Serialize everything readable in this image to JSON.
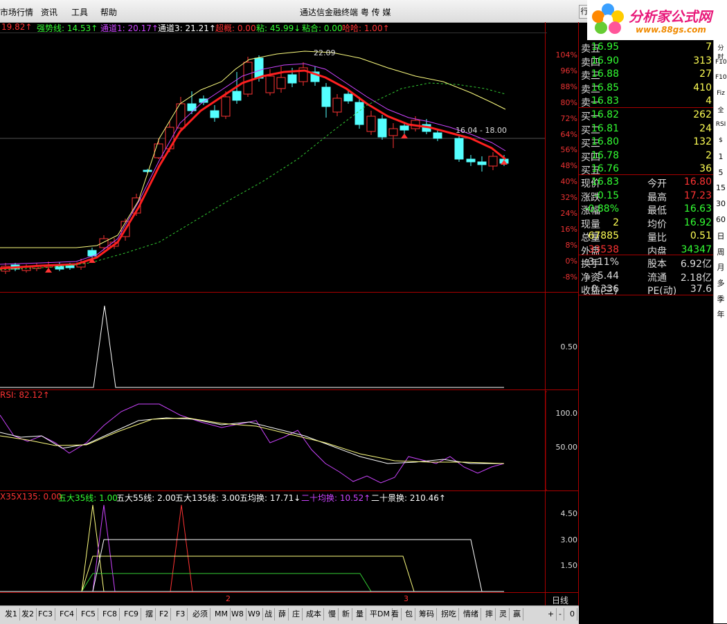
{
  "menu": {
    "items": [
      "市场行情",
      "资讯",
      "工具",
      "帮助"
    ],
    "title": "通达信金融终端  粤 传 媒",
    "left_button": "行"
  },
  "logo": {
    "brand": "分析家公式网",
    "url": "www.88gs.com"
  },
  "info_main": [
    {
      "text": "19.82↑",
      "color": "#ff3333"
    },
    {
      "text": "强势线: 14.53↑",
      "color": "#33ff33"
    },
    {
      "text": "通道1: 20.17↑",
      "color": "#cc44ff"
    },
    {
      "text": "通道3: 21.21↑",
      "color": "#ffffff"
    },
    {
      "text": "超概: 0.00",
      "color": "#ff3333"
    },
    {
      "text": "粘: 45.99↓",
      "color": "#33ff33"
    },
    {
      "text": "粘合: 0.00",
      "color": "#33ff33"
    },
    {
      "text": "哈哈: 1.00↑",
      "color": "#ff3333"
    }
  ],
  "price_axis": [
    "104%",
    "96%",
    "88%",
    "80%",
    "72%",
    "64%",
    "56%",
    "48%",
    "40%",
    "32%",
    "24%",
    "16%",
    "8%",
    "0%",
    "-8%"
  ],
  "annotations": {
    "high": "22.09",
    "range": "16.04 - 18.00"
  },
  "ind1_axis": [
    "0.50"
  ],
  "rsi_label": "RSI: 82.12↑",
  "rsi_axis": [
    "100.0",
    "50.00"
  ],
  "ind3_info": [
    {
      "text": "X35X135: 0.00",
      "color": "#ff3333"
    },
    {
      "text": "五大35线: 1.00",
      "color": "#33ff33"
    },
    {
      "text": "五大55线: 2.00",
      "color": "#ffffff"
    },
    {
      "text": "五大135线: 3.00",
      "color": "#ffffff"
    },
    {
      "text": "五均换: 17.71↓",
      "color": "#ffffff"
    },
    {
      "text": "二十均换: 10.52↑",
      "color": "#cc44ff"
    },
    {
      "text": "二十景换: 210.46↑",
      "color": "#ffffff"
    }
  ],
  "ind3_axis": [
    "4.50",
    "3.00",
    "1.50"
  ],
  "xaxis_marks": [
    "2",
    "3"
  ],
  "period_label": "日线",
  "quote": {
    "asks": [
      [
        "卖五",
        "16.95",
        "7"
      ],
      [
        "卖四",
        "16.90",
        "313"
      ],
      [
        "卖三",
        "16.88",
        "27"
      ],
      [
        "卖二",
        "16.85",
        "410"
      ],
      [
        "卖一",
        "16.83",
        "4"
      ]
    ],
    "bids": [
      [
        "买一",
        "16.82",
        "262"
      ],
      [
        "买二",
        "16.81",
        "24"
      ],
      [
        "买三",
        "16.80",
        "132"
      ],
      [
        "买四",
        "16.78",
        "2"
      ],
      [
        "买五",
        "16.76",
        "36"
      ]
    ],
    "stats": [
      [
        "现价",
        "16.83",
        "今开",
        "16.80"
      ],
      [
        "涨跌",
        "-0.15",
        "最高",
        "17.23"
      ],
      [
        "涨幅",
        "-0.88%",
        "最低",
        "16.63"
      ],
      [
        "现量",
        "2",
        "均价",
        "16.92"
      ],
      [
        "总量",
        "67885",
        "量比",
        "0.51"
      ],
      [
        "外盘",
        "33538",
        "内盘",
        "34347"
      ],
      [
        "换手",
        "3.11%",
        "股本",
        "6.92亿"
      ],
      [
        "净资",
        "5.44",
        "流通",
        "2.18亿"
      ],
      [
        "收益(三)",
        "0.336",
        "PE(动)",
        "37.6"
      ]
    ]
  },
  "sidebar": [
    "分时",
    "F10",
    "F10",
    "Fiz",
    "全",
    "RSI",
    "$",
    "1",
    "5",
    "15",
    "30",
    "60",
    "日",
    "周",
    "月",
    "多",
    "季",
    "年"
  ],
  "bottom_tabs": [
    "发1",
    "发2",
    "FC3",
    "FC4",
    "FC5",
    "FC8",
    "FC9",
    "摆",
    "F2",
    "F3",
    "必须",
    "MM",
    "W8",
    "W9",
    "战",
    "薛",
    "庄",
    "成本",
    "慢",
    "新",
    "量",
    "平DM",
    "看",
    "包",
    "筹码",
    "拐吃",
    "情绪",
    "摔",
    "灵",
    "赢"
  ],
  "bottom_controls": [
    "+",
    "-",
    "0"
  ],
  "colors": {
    "up": "#ff3333",
    "down": "#54ffff",
    "frame": "#aa0000",
    "ma_red": "#ff2020",
    "yellow": "#ffff80",
    "green": "#33cc33",
    "purple": "#cc44ff"
  }
}
